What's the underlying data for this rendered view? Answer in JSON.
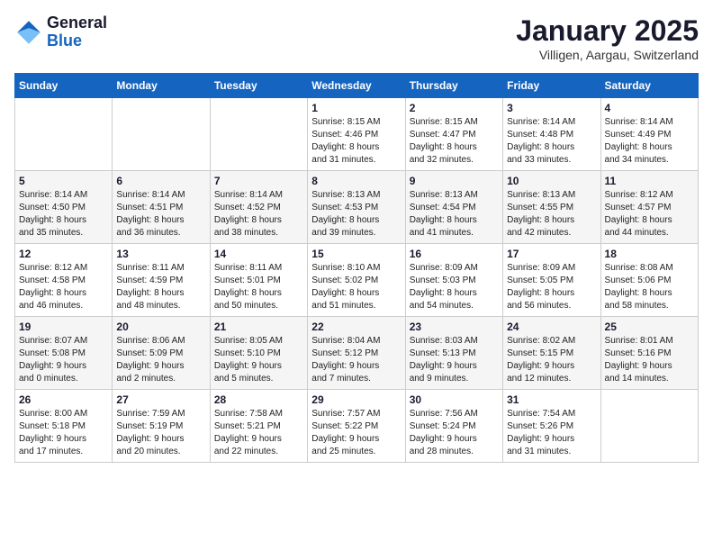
{
  "logo": {
    "general": "General",
    "blue": "Blue"
  },
  "header": {
    "month": "January 2025",
    "location": "Villigen, Aargau, Switzerland"
  },
  "weekdays": [
    "Sunday",
    "Monday",
    "Tuesday",
    "Wednesday",
    "Thursday",
    "Friday",
    "Saturday"
  ],
  "weeks": [
    [
      {
        "day": "",
        "sunrise": "",
        "sunset": "",
        "daylight": ""
      },
      {
        "day": "",
        "sunrise": "",
        "sunset": "",
        "daylight": ""
      },
      {
        "day": "",
        "sunrise": "",
        "sunset": "",
        "daylight": ""
      },
      {
        "day": "1",
        "sunrise": "Sunrise: 8:15 AM",
        "sunset": "Sunset: 4:46 PM",
        "daylight": "Daylight: 8 hours and 31 minutes."
      },
      {
        "day": "2",
        "sunrise": "Sunrise: 8:15 AM",
        "sunset": "Sunset: 4:47 PM",
        "daylight": "Daylight: 8 hours and 32 minutes."
      },
      {
        "day": "3",
        "sunrise": "Sunrise: 8:14 AM",
        "sunset": "Sunset: 4:48 PM",
        "daylight": "Daylight: 8 hours and 33 minutes."
      },
      {
        "day": "4",
        "sunrise": "Sunrise: 8:14 AM",
        "sunset": "Sunset: 4:49 PM",
        "daylight": "Daylight: 8 hours and 34 minutes."
      }
    ],
    [
      {
        "day": "5",
        "sunrise": "Sunrise: 8:14 AM",
        "sunset": "Sunset: 4:50 PM",
        "daylight": "Daylight: 8 hours and 35 minutes."
      },
      {
        "day": "6",
        "sunrise": "Sunrise: 8:14 AM",
        "sunset": "Sunset: 4:51 PM",
        "daylight": "Daylight: 8 hours and 36 minutes."
      },
      {
        "day": "7",
        "sunrise": "Sunrise: 8:14 AM",
        "sunset": "Sunset: 4:52 PM",
        "daylight": "Daylight: 8 hours and 38 minutes."
      },
      {
        "day": "8",
        "sunrise": "Sunrise: 8:13 AM",
        "sunset": "Sunset: 4:53 PM",
        "daylight": "Daylight: 8 hours and 39 minutes."
      },
      {
        "day": "9",
        "sunrise": "Sunrise: 8:13 AM",
        "sunset": "Sunset: 4:54 PM",
        "daylight": "Daylight: 8 hours and 41 minutes."
      },
      {
        "day": "10",
        "sunrise": "Sunrise: 8:13 AM",
        "sunset": "Sunset: 4:55 PM",
        "daylight": "Daylight: 8 hours and 42 minutes."
      },
      {
        "day": "11",
        "sunrise": "Sunrise: 8:12 AM",
        "sunset": "Sunset: 4:57 PM",
        "daylight": "Daylight: 8 hours and 44 minutes."
      }
    ],
    [
      {
        "day": "12",
        "sunrise": "Sunrise: 8:12 AM",
        "sunset": "Sunset: 4:58 PM",
        "daylight": "Daylight: 8 hours and 46 minutes."
      },
      {
        "day": "13",
        "sunrise": "Sunrise: 8:11 AM",
        "sunset": "Sunset: 4:59 PM",
        "daylight": "Daylight: 8 hours and 48 minutes."
      },
      {
        "day": "14",
        "sunrise": "Sunrise: 8:11 AM",
        "sunset": "Sunset: 5:01 PM",
        "daylight": "Daylight: 8 hours and 50 minutes."
      },
      {
        "day": "15",
        "sunrise": "Sunrise: 8:10 AM",
        "sunset": "Sunset: 5:02 PM",
        "daylight": "Daylight: 8 hours and 51 minutes."
      },
      {
        "day": "16",
        "sunrise": "Sunrise: 8:09 AM",
        "sunset": "Sunset: 5:03 PM",
        "daylight": "Daylight: 8 hours and 54 minutes."
      },
      {
        "day": "17",
        "sunrise": "Sunrise: 8:09 AM",
        "sunset": "Sunset: 5:05 PM",
        "daylight": "Daylight: 8 hours and 56 minutes."
      },
      {
        "day": "18",
        "sunrise": "Sunrise: 8:08 AM",
        "sunset": "Sunset: 5:06 PM",
        "daylight": "Daylight: 8 hours and 58 minutes."
      }
    ],
    [
      {
        "day": "19",
        "sunrise": "Sunrise: 8:07 AM",
        "sunset": "Sunset: 5:08 PM",
        "daylight": "Daylight: 9 hours and 0 minutes."
      },
      {
        "day": "20",
        "sunrise": "Sunrise: 8:06 AM",
        "sunset": "Sunset: 5:09 PM",
        "daylight": "Daylight: 9 hours and 2 minutes."
      },
      {
        "day": "21",
        "sunrise": "Sunrise: 8:05 AM",
        "sunset": "Sunset: 5:10 PM",
        "daylight": "Daylight: 9 hours and 5 minutes."
      },
      {
        "day": "22",
        "sunrise": "Sunrise: 8:04 AM",
        "sunset": "Sunset: 5:12 PM",
        "daylight": "Daylight: 9 hours and 7 minutes."
      },
      {
        "day": "23",
        "sunrise": "Sunrise: 8:03 AM",
        "sunset": "Sunset: 5:13 PM",
        "daylight": "Daylight: 9 hours and 9 minutes."
      },
      {
        "day": "24",
        "sunrise": "Sunrise: 8:02 AM",
        "sunset": "Sunset: 5:15 PM",
        "daylight": "Daylight: 9 hours and 12 minutes."
      },
      {
        "day": "25",
        "sunrise": "Sunrise: 8:01 AM",
        "sunset": "Sunset: 5:16 PM",
        "daylight": "Daylight: 9 hours and 14 minutes."
      }
    ],
    [
      {
        "day": "26",
        "sunrise": "Sunrise: 8:00 AM",
        "sunset": "Sunset: 5:18 PM",
        "daylight": "Daylight: 9 hours and 17 minutes."
      },
      {
        "day": "27",
        "sunrise": "Sunrise: 7:59 AM",
        "sunset": "Sunset: 5:19 PM",
        "daylight": "Daylight: 9 hours and 20 minutes."
      },
      {
        "day": "28",
        "sunrise": "Sunrise: 7:58 AM",
        "sunset": "Sunset: 5:21 PM",
        "daylight": "Daylight: 9 hours and 22 minutes."
      },
      {
        "day": "29",
        "sunrise": "Sunrise: 7:57 AM",
        "sunset": "Sunset: 5:22 PM",
        "daylight": "Daylight: 9 hours and 25 minutes."
      },
      {
        "day": "30",
        "sunrise": "Sunrise: 7:56 AM",
        "sunset": "Sunset: 5:24 PM",
        "daylight": "Daylight: 9 hours and 28 minutes."
      },
      {
        "day": "31",
        "sunrise": "Sunrise: 7:54 AM",
        "sunset": "Sunset: 5:26 PM",
        "daylight": "Daylight: 9 hours and 31 minutes."
      },
      {
        "day": "",
        "sunrise": "",
        "sunset": "",
        "daylight": ""
      }
    ]
  ]
}
